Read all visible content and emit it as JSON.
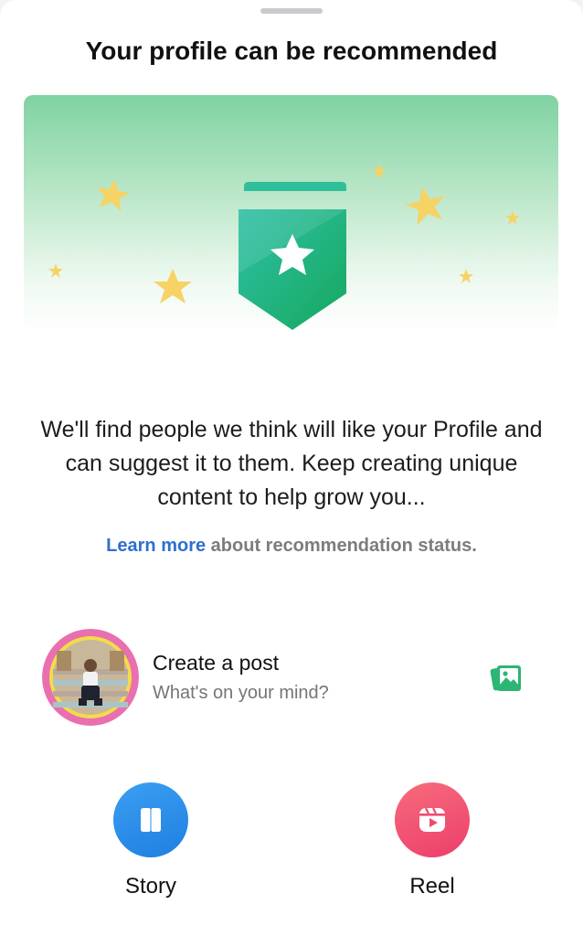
{
  "sheet": {
    "title": "Your profile can be recommended"
  },
  "hero": {
    "badge_icon": "star-badge-icon",
    "decoration": "stars"
  },
  "description": "We'll find people we think will like your Profile and can suggest it to them. Keep creating unique content to help grow you...",
  "learn_more": {
    "link_label": "Learn more",
    "rest_text": " about recommendation status."
  },
  "create_post": {
    "title": "Create a post",
    "placeholder": "What's on your mind?",
    "photo_icon": "photo-icon"
  },
  "actions": [
    {
      "label": "Story",
      "icon": "book-icon",
      "color": "#1f7fe0"
    },
    {
      "label": "Reel",
      "icon": "reel-play-icon",
      "color": "#ec3f6c"
    }
  ],
  "colors": {
    "accent_green": "#1aa865",
    "link_blue": "#2e6fd0",
    "star_yellow": "#f7d264"
  }
}
